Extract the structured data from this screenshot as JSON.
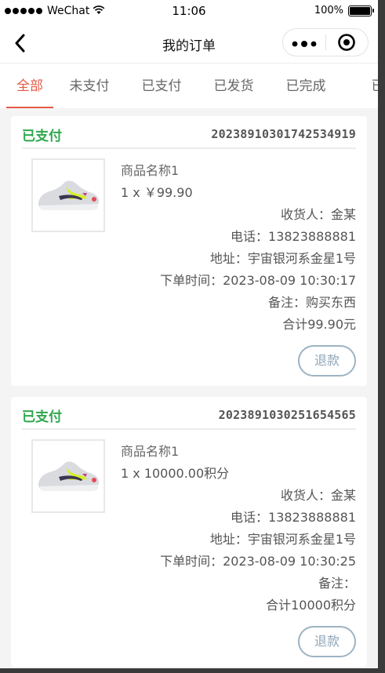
{
  "status_bar": {
    "carrier": "WeChat",
    "time": "11:06",
    "battery": "100%",
    "battery_level": 1.0
  },
  "nav": {
    "title": "我的订单"
  },
  "tabs": [
    {
      "label": "全部",
      "active": true
    },
    {
      "label": "未支付",
      "active": false
    },
    {
      "label": "已支付",
      "active": false
    },
    {
      "label": "已发货",
      "active": false
    },
    {
      "label": "已完成",
      "active": false
    },
    {
      "label": "已",
      "active": false
    }
  ],
  "orders": [
    {
      "status": "已支付",
      "order_no": "2023891030174253491 9",
      "product_name": "商品名称1",
      "quantity_price": "1 x ￥99.90",
      "receiver": "收货人：金某",
      "phone": "电话：13823888881",
      "address": "地址：宇宙银河系金星1号",
      "order_time": "下单时间：2023-08-09 10:30:17",
      "note": "备注：购买东西",
      "total": "合计99.90元",
      "refund_label": "退款"
    },
    {
      "status": "已支付",
      "order_no": "2023891030251654565",
      "product_name": "商品名称1",
      "quantity_price": "1 x 10000.00积分",
      "receiver": "收货人：金某",
      "phone": "电话：13823888881",
      "address": "地址：宇宙银河系金星1号",
      "order_time": "下单时间：2023-08-09 10:30:25",
      "note": "备注：",
      "total": "合计10000积分",
      "refund_label": "退款"
    }
  ],
  "colors": {
    "accent": "#e45a47",
    "status_green": "#2ea84d",
    "refund_border": "#9db3c3"
  }
}
